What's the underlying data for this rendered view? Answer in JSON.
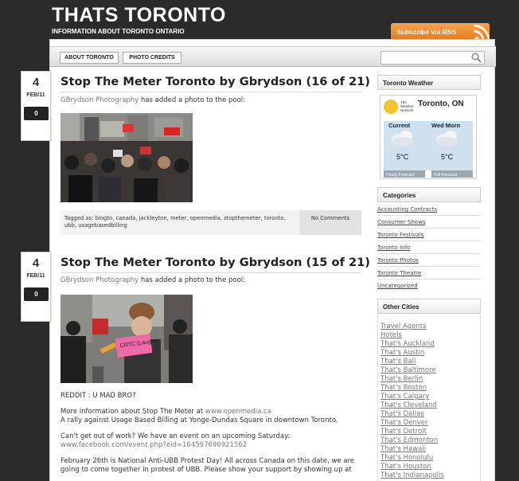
{
  "site": {
    "title": "THATS TORONTO",
    "tagline": "INFORMATION ABOUT TORONTO ONTARIO",
    "rss_label": "Subscribe via RSS"
  },
  "nav": [
    "ABOUT TORONTO",
    "PHOTO CREDITS"
  ],
  "posts": [
    {
      "day": "4",
      "month": "FEB/11",
      "comments": "0",
      "title": "Stop The Meter Toronto by Gbrydson (16 of 21)",
      "author": "GBrydson Photography",
      "byline_suffix": "has added a photo to the pool:",
      "tags_label": "Tagged as:",
      "tags": [
        "blogto",
        "canada",
        "jackleyton",
        "meter",
        "openmedia",
        "stopthemeter",
        "toronto",
        "ubb",
        "usagebasedbilling"
      ],
      "no_comments": "No Comments"
    },
    {
      "day": "4",
      "month": "FEB/11",
      "comments": "0",
      "title": "Stop The Meter Toronto by Gbrydson (15 of 21)",
      "author": "GBrydson Photography",
      "byline_suffix": "has added a photo to the pool:",
      "sign_text": "CRTC (Laughs)",
      "p1": "REDDIT : U MAD BRO?",
      "p2_prefix": "More information about Stop The Meter at",
      "p2_link": "www.openmedia.ca",
      "p2_line2": "A rally against Usage Based Billing at Yonge-Dundas Square in downtown Toronto.",
      "p3": "Can't get out of work? We have an event on an upcoming Saturday:",
      "p3_link": "www.facebook.com/event.php?eid=164597696921562",
      "p4_line1": "February 26th is National Anti-UBB Protest Day! All across Canada on this date, we are",
      "p4_line2": "going to come together in protest of UBB. Please show your support by showing up at"
    }
  ],
  "sidebar": {
    "weather_title": "Toronto Weather",
    "weather": {
      "network_line1": "The",
      "network_line2": "Weather",
      "network_line3": "Network",
      "city": "Toronto, ON",
      "current_label": "Current",
      "current_temp": "5°C",
      "forecast_label": "Wed Morn",
      "forecast_temp": "5°C",
      "hourly": "Hourly Forecast",
      "full": "Full Forecast"
    },
    "categories_title": "Categories",
    "categories": [
      "Accounting Contracts",
      "Consumer Shows",
      "Toronto Festivals",
      "Toronto Info",
      "Toronto Photos",
      "Toronto Theatre",
      "Uncategorized"
    ],
    "cities_title": "Other Cities",
    "cities": [
      "Travel Agents",
      "Hotels",
      "That's Auckland",
      "That's Austin",
      "That's Bali",
      "That's Baltimore",
      "That's Berlin",
      "That's Boston",
      "That's Calgary",
      "That's Cleveland",
      "That's Dallas",
      "That's Denver",
      "That's Detroit",
      "That's Edmonton",
      "That's Hawaii",
      "That's Honolulu",
      "That's Houston",
      "That's Indianapolis"
    ]
  }
}
